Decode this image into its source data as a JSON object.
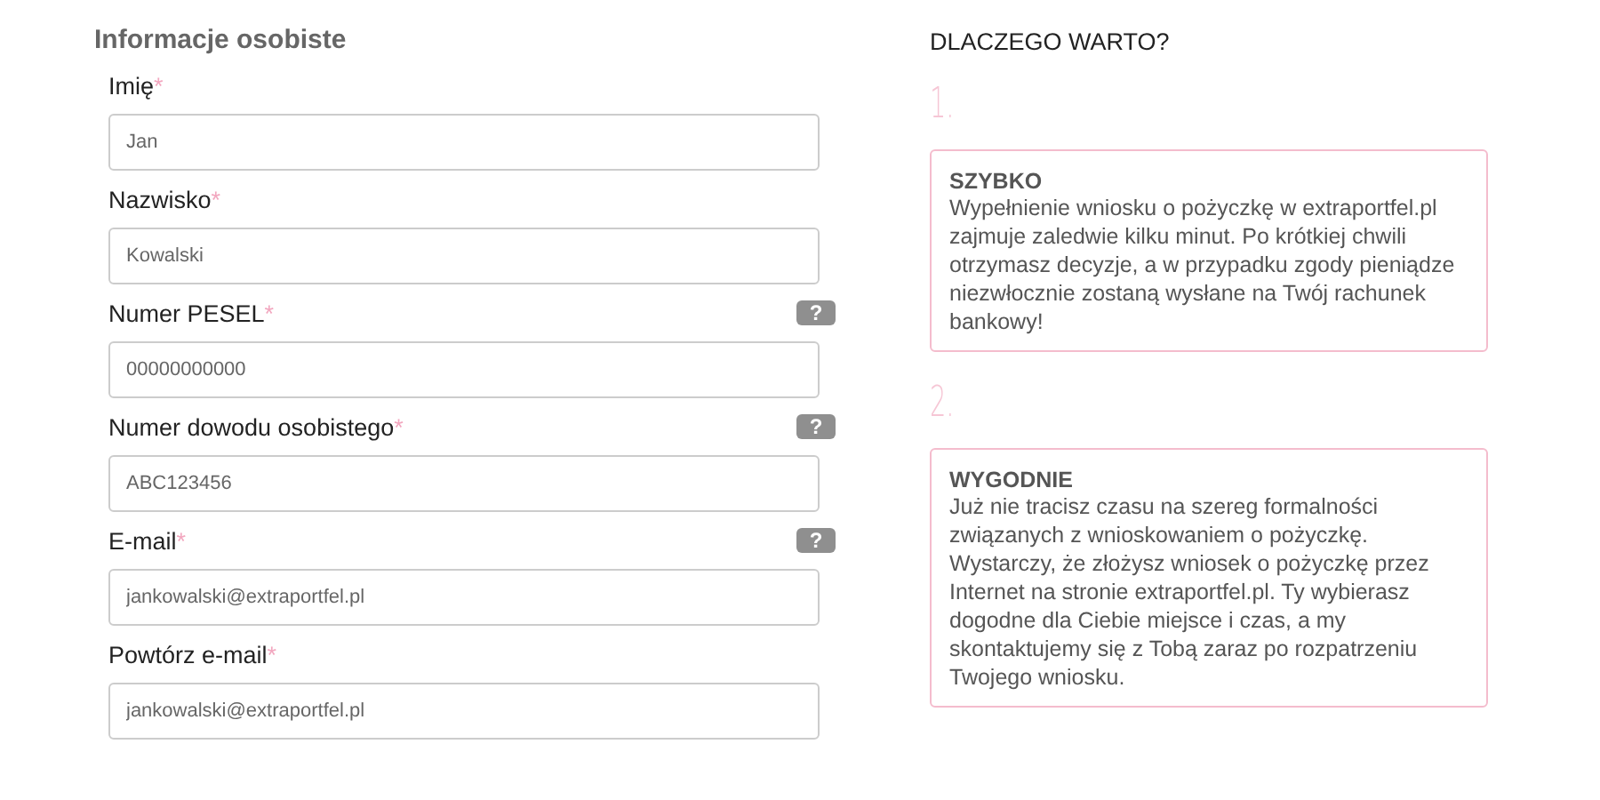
{
  "form": {
    "title": "Informacje osobiste",
    "fields": [
      {
        "label": "Imię",
        "asterisk": "*",
        "placeholder": "Jan"
      },
      {
        "label": "Nazwisko",
        "asterisk": "*",
        "placeholder": "Kowalski"
      },
      {
        "label": "Numer PESEL",
        "asterisk": "*",
        "help": "?",
        "placeholder": "00000000000"
      },
      {
        "label": "Numer dowodu osobistego",
        "asterisk": "*",
        "help": "?",
        "placeholder": "ABC123456"
      },
      {
        "label": "E-mail",
        "asterisk": "*",
        "help": "?",
        "placeholder": "jankowalski@extraportfel.pl"
      },
      {
        "label": "Powtórz e-mail",
        "asterisk": "*",
        "placeholder": "jankowalski@extraportfel.pl"
      }
    ]
  },
  "why": {
    "title": "DLACZEGO WARTO?",
    "reasons": [
      {
        "number": "1.",
        "heading": "SZYBKO",
        "text": "Wypełnienie wniosku o pożyczkę w extraportfel.pl zajmuje zaledwie kilku minut. Po krótkiej chwili otrzymasz decyzje, a w przypadku zgody pieniądze niezwłocznie zostaną wysłane na Twój rachunek bankowy!"
      },
      {
        "number": "2.",
        "heading": "WYGODNIE",
        "text": "Już nie tracisz czasu na szereg formalności związanych z wnioskowaniem o pożyczkę. Wystarczy, że złożysz wniosek o pożyczkę przez Internet na stronie extraportfel.pl. Ty wybierasz dogodne dla Ciebie miejsce i czas, a my skontaktujemy się z Tobą zaraz po rozpatrzeniu Twojego wniosku."
      }
    ]
  }
}
